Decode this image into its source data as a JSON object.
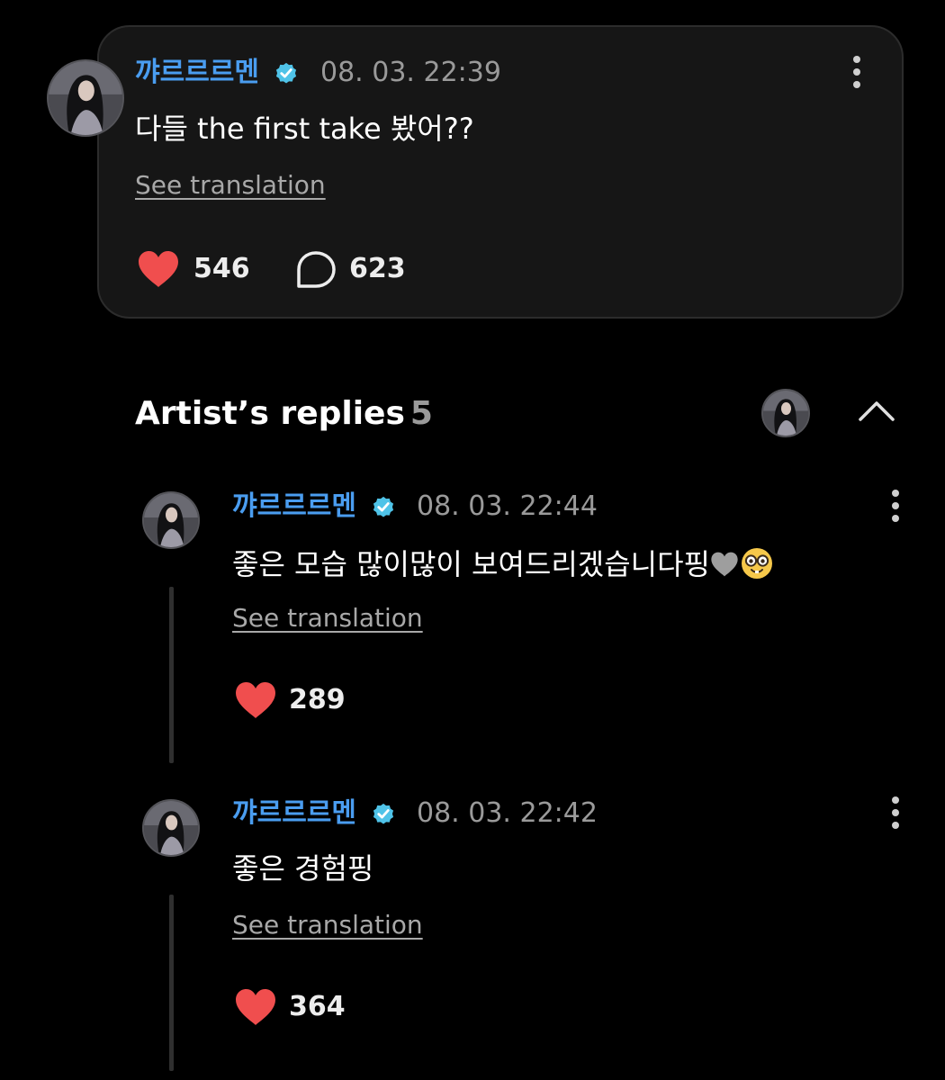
{
  "colors": {
    "background": "#000000",
    "card": "#161616",
    "username": "#4a9df0",
    "verified_badge": "#4fc3e8",
    "heart": "#f04e4e",
    "timestamp": "#9a9a9a"
  },
  "post": {
    "author": "꺄르르르멘",
    "timestamp": "08. 03. 22:39",
    "text": "다들 the first take 봤어??",
    "see_translation": "See translation",
    "likes": "546",
    "comments": "623",
    "icons": [
      "verified-badge-icon",
      "kebab-menu-icon",
      "heart-icon",
      "comment-bubble-icon"
    ]
  },
  "artist_replies": {
    "title": "Artist’s replies",
    "count": "5",
    "icons": [
      "artist-avatar",
      "chevron-up-icon"
    ]
  },
  "replies": [
    {
      "author": "꺄르르르멘",
      "timestamp": "08. 03. 22:44",
      "text": "좋은 모습 많이많이 보여드리겠습니다핑",
      "emojis": [
        "grey-heart-emoji",
        "nerd-face-emoji"
      ],
      "see_translation": "See translation",
      "likes": "289"
    },
    {
      "author": "꺄르르르멘",
      "timestamp": "08. 03. 22:42",
      "text": "좋은 경험핑",
      "see_translation": "See translation",
      "likes": "364"
    }
  ]
}
